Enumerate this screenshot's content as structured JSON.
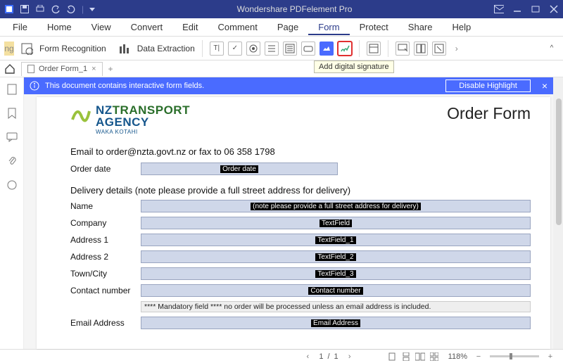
{
  "app": {
    "title": "Wondershare PDFelement Pro"
  },
  "menu": [
    "File",
    "Home",
    "View",
    "Convert",
    "Edit",
    "Comment",
    "Page",
    "Form",
    "Protect",
    "Share",
    "Help"
  ],
  "menu_active": "Form",
  "ribbon": {
    "form_recognition": "Form Recognition",
    "data_extraction": "Data Extraction",
    "tooltip": "Add digital signature"
  },
  "tab": {
    "name": "Order Form_1"
  },
  "banner": {
    "msg": "This document contains interactive form fields.",
    "btn": "Disable Highlight"
  },
  "doc": {
    "logo": {
      "nz": "NZ",
      "transport": "TRANSPORT",
      "agency": "AGENCY",
      "sub": "WAKA KOTAHI"
    },
    "title": "Order Form",
    "email_line": "Email to order@nzta.govt.nz or fax to 06 358 1798",
    "section": "Delivery details (note please provide a full street address for delivery)",
    "labels": {
      "order_date": "Order date",
      "name": "Name",
      "company": "Company",
      "addr1": "Address 1",
      "addr2": "Address 2",
      "town": "Town/City",
      "contact": "Contact number",
      "email": "Email Address"
    },
    "badges": {
      "order_date": "Order date",
      "name": "(note please provide a full street address for delivery)",
      "company": "TextField",
      "addr1": "TextField_1",
      "addr2": "TextField_2",
      "town": "TextField_3",
      "contact": "Contact number",
      "email": "Email Address"
    },
    "mandatory": "**** Mandatory field **** no order will be processed unless an email address is included."
  },
  "status": {
    "page_current": "1",
    "page_sep": "/",
    "page_total": "1",
    "zoom": "118%"
  }
}
